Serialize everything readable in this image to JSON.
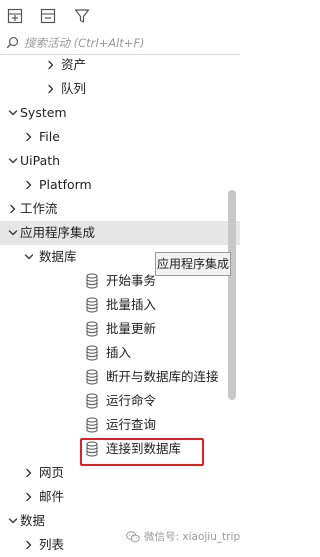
{
  "toolbar": {
    "buttons": [
      {
        "icon": "expand-all-icon"
      },
      {
        "icon": "collapse-all-icon"
      },
      {
        "icon": "filter-icon"
      }
    ]
  },
  "search": {
    "icon": "search-icon",
    "placeholder": "搜索活动 (Ctrl+Alt+F)"
  },
  "tree": {
    "rows": [
      {
        "label": "资产",
        "level": 2,
        "expanded": false,
        "icon": "chevron-right-icon"
      },
      {
        "label": "队列",
        "level": 2,
        "expanded": false,
        "icon": "chevron-right-icon"
      },
      {
        "label": "System",
        "level": 0,
        "expanded": true,
        "icon": "chevron-down-icon"
      },
      {
        "label": "File",
        "level": 1,
        "expanded": false,
        "icon": "chevron-right-icon"
      },
      {
        "label": "UiPath",
        "level": 0,
        "expanded": true,
        "icon": "chevron-down-icon"
      },
      {
        "label": "Platform",
        "level": 1,
        "expanded": false,
        "icon": "chevron-right-icon"
      },
      {
        "label": "工作流",
        "level": 0,
        "expanded": false,
        "icon": "chevron-right-icon"
      },
      {
        "label": "应用程序集成",
        "level": 0,
        "expanded": true,
        "icon": "chevron-down-icon",
        "selected": true
      },
      {
        "label": "数据库",
        "level": 1,
        "expanded": true,
        "icon": "chevron-down-icon"
      },
      {
        "label": "开始事务",
        "level": 2,
        "activity": true,
        "icon": "database-icon"
      },
      {
        "label": "批量插入",
        "level": 2,
        "activity": true,
        "icon": "database-icon"
      },
      {
        "label": "批量更新",
        "level": 2,
        "activity": true,
        "icon": "database-icon"
      },
      {
        "label": "插入",
        "level": 2,
        "activity": true,
        "icon": "database-icon"
      },
      {
        "label": "断开与数据库的连接",
        "level": 2,
        "activity": true,
        "icon": "database-icon"
      },
      {
        "label": "运行命令",
        "level": 2,
        "activity": true,
        "icon": "database-icon"
      },
      {
        "label": "运行查询",
        "level": 2,
        "activity": true,
        "icon": "database-icon"
      },
      {
        "label": "连接到数据库",
        "level": 2,
        "activity": true,
        "icon": "database-icon",
        "highlighted": true
      },
      {
        "label": "网页",
        "level": 1,
        "expanded": false,
        "icon": "chevron-right-icon"
      },
      {
        "label": "邮件",
        "level": 1,
        "expanded": false,
        "icon": "chevron-right-icon"
      },
      {
        "label": "数据",
        "level": 0,
        "expanded": true,
        "icon": "chevron-down-icon"
      },
      {
        "label": "列表",
        "level": 1,
        "expanded": false,
        "icon": "chevron-right-icon"
      }
    ]
  },
  "tooltip": {
    "text": "应用程序集成"
  },
  "watermark": {
    "text": "微信号: xiaojiu_trip",
    "icon": "wechat-icon"
  },
  "colors": {
    "highlight_border": "#e02020",
    "selected_row": "#e6e6e6",
    "icon": "#555555"
  }
}
